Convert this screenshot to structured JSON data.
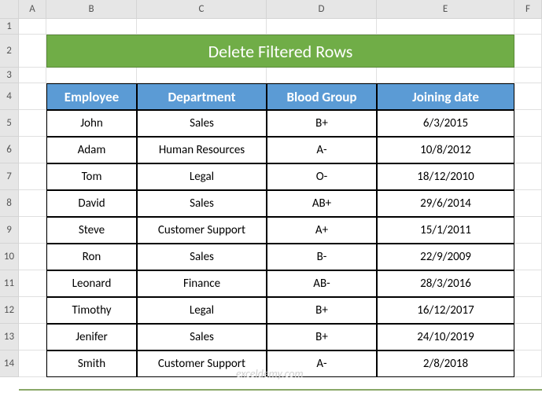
{
  "columns": [
    "A",
    "B",
    "C",
    "D",
    "E",
    "F"
  ],
  "rows": [
    "1",
    "2",
    "3",
    "4",
    "5",
    "6",
    "7",
    "8",
    "9",
    "10",
    "11",
    "12",
    "13",
    "14"
  ],
  "title": "Delete Filtered Rows",
  "headers": {
    "employee": "Employee",
    "department": "Department",
    "blood_group": "Blood Group",
    "joining_date": "Joining date"
  },
  "table": [
    {
      "employee": "John",
      "department": "Sales",
      "blood_group": "B+",
      "joining_date": "6/3/2015"
    },
    {
      "employee": "Adam",
      "department": "Human Resources",
      "blood_group": "A-",
      "joining_date": "10/8/2012"
    },
    {
      "employee": "Tom",
      "department": "Legal",
      "blood_group": "O-",
      "joining_date": "18/12/2010"
    },
    {
      "employee": "David",
      "department": "Sales",
      "blood_group": "AB+",
      "joining_date": "29/6/2014"
    },
    {
      "employee": "Steve",
      "department": "Customer Support",
      "blood_group": "A+",
      "joining_date": "15/1/2011"
    },
    {
      "employee": "Ron",
      "department": "Sales",
      "blood_group": "B-",
      "joining_date": "22/9/2009"
    },
    {
      "employee": "Leonard",
      "department": "Finance",
      "blood_group": "AB-",
      "joining_date": "28/3/2016"
    },
    {
      "employee": "Timothy",
      "department": "Legal",
      "blood_group": "B+",
      "joining_date": "16/12/2017"
    },
    {
      "employee": "Jenifer",
      "department": "Sales",
      "blood_group": "B+",
      "joining_date": "24/10/2019"
    },
    {
      "employee": "Smith",
      "department": "Customer Support",
      "blood_group": "A-",
      "joining_date": "2/8/2018"
    }
  ],
  "watermark": "exceldemy.com"
}
